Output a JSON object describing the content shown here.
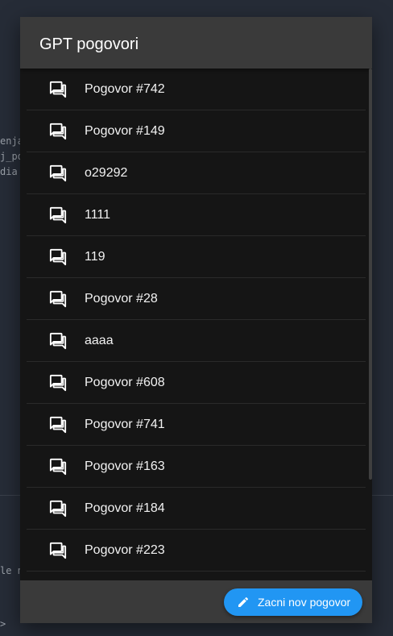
{
  "background": {
    "code_lines": [
      "enja",
      "j_po",
      "dia",
      "le n",
      ">"
    ]
  },
  "dialog": {
    "title": "GPT pogovori",
    "items": [
      {
        "label": "Pogovor #742",
        "icon": "forum-icon"
      },
      {
        "label": "Pogovor #149",
        "icon": "forum-icon"
      },
      {
        "label": "o29292",
        "icon": "forum-icon"
      },
      {
        "label": "1111",
        "icon": "forum-icon"
      },
      {
        "label": "119",
        "icon": "forum-icon"
      },
      {
        "label": "Pogovor #28",
        "icon": "forum-icon"
      },
      {
        "label": "aaaa",
        "icon": "forum-icon"
      },
      {
        "label": "Pogovor #608",
        "icon": "forum-icon"
      },
      {
        "label": "Pogovor #741",
        "icon": "forum-icon"
      },
      {
        "label": "Pogovor #163",
        "icon": "forum-icon"
      },
      {
        "label": "Pogovor #184",
        "icon": "forum-icon"
      },
      {
        "label": "Pogovor #223",
        "icon": "forum-icon"
      }
    ],
    "new_button": {
      "label": "Zacni nov pogovor",
      "icon": "pencil-icon"
    }
  },
  "colors": {
    "accent": "#2196f3",
    "header": "#3a3a3a",
    "list_bg": "#151515"
  }
}
